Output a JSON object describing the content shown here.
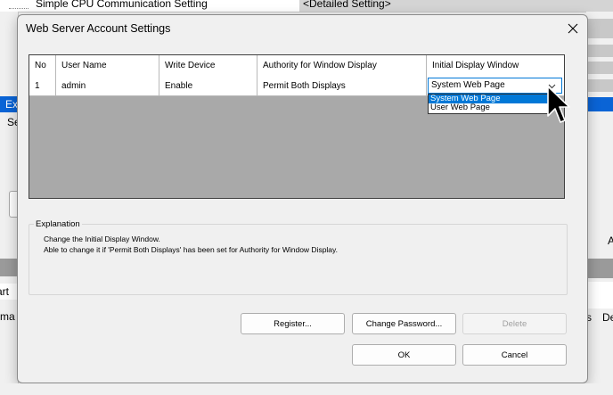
{
  "background": {
    "tree_item": "Simple CPU Communication Setting",
    "tree_value": "<Detailed Setting>",
    "left_sel": "Ex",
    "left_se": "Se",
    "left_art": "art W",
    "left_rma": "rma",
    "right_a": "A",
    "right_s": "s",
    "right_de": "De"
  },
  "dialog": {
    "title": "Web Server Account Settings",
    "close_glyph": "close-icon"
  },
  "grid": {
    "headers": [
      "No",
      "User Name",
      "Write Device",
      "Authority for Window Display",
      "Initial Display Window"
    ],
    "rows": [
      {
        "no": "1",
        "user": "admin",
        "write": "Enable",
        "authority": "Permit Both Displays",
        "initial": "System Web Page"
      }
    ],
    "dropdown": {
      "selected": "System Web Page",
      "options": [
        "System Web Page",
        "User Web Page"
      ],
      "highlighted_index": 0
    }
  },
  "explanation": {
    "legend": "Explanation",
    "lines": [
      "Change the Initial Display Window.",
      "Able to change it if 'Permit Both Displays' has been set for Authority for Window Display."
    ]
  },
  "buttons": {
    "register": "Register...",
    "change_password": "Change Password...",
    "delete": "Delete",
    "ok": "OK",
    "cancel": "Cancel"
  },
  "colors": {
    "accent": "#0078d7",
    "grid_background": "#a9a9a9",
    "selection_blue": "#0a64d6"
  }
}
